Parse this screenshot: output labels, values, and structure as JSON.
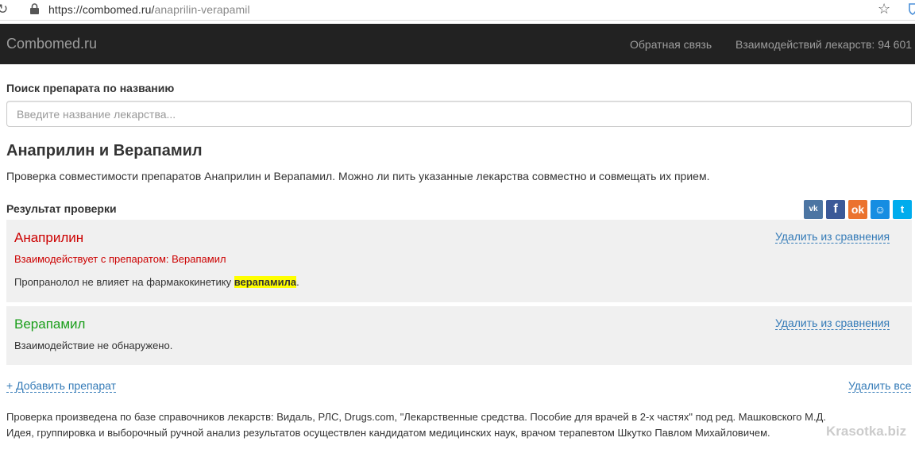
{
  "browser": {
    "url_host": "https://combomed.ru/",
    "url_path": "anaprilin-verapamil"
  },
  "navbar": {
    "brand": "Combomed.ru",
    "feedback": "Обратная связь",
    "count": "Взаимодействий лекарств: 94 601"
  },
  "search": {
    "label": "Поиск препарата по названию",
    "placeholder": "Введите название лекарства..."
  },
  "page": {
    "title": "Анаприлин и Верапамил",
    "description": "Проверка совместимости препаратов Анаприлин и Верапамил. Можно ли пить указанные лекарства совместно и совмещать их прием.",
    "result_heading": "Результат проверки"
  },
  "share": {
    "vk": "vk",
    "fb": "f",
    "ok": "ok",
    "mm": "☺",
    "tw": "t"
  },
  "drugs": [
    {
      "name": "Анаприлин",
      "remove_label": "Удалить из сравнения",
      "interacts": "Взаимодействует с препаратом: Верапамил",
      "note_before": "Пропранолол не влияет на фармакокинетику ",
      "note_highlight": "верапамила",
      "note_after": "."
    },
    {
      "name": "Верапамил",
      "remove_label": "Удалить из сравнения",
      "status": "Взаимодействие не обнаружено."
    }
  ],
  "actions": {
    "add": "+ Добавить препарат",
    "remove_all": "Удалить все"
  },
  "footer": {
    "line1": "Проверка произведена по базе справочников лекарств: Видаль, РЛС, Drugs.com, \"Лекарственные средства. Пособие для врачей в 2-х частях\" под ред. Машковского М.Д.",
    "line2": "Идея, группировка и выборочный ручной анализ результатов осуществлен кандидатом медицинских наук, врачом терапевтом Шкутко Павлом Михайловичем."
  },
  "watermark": "Krasotka.biz"
}
